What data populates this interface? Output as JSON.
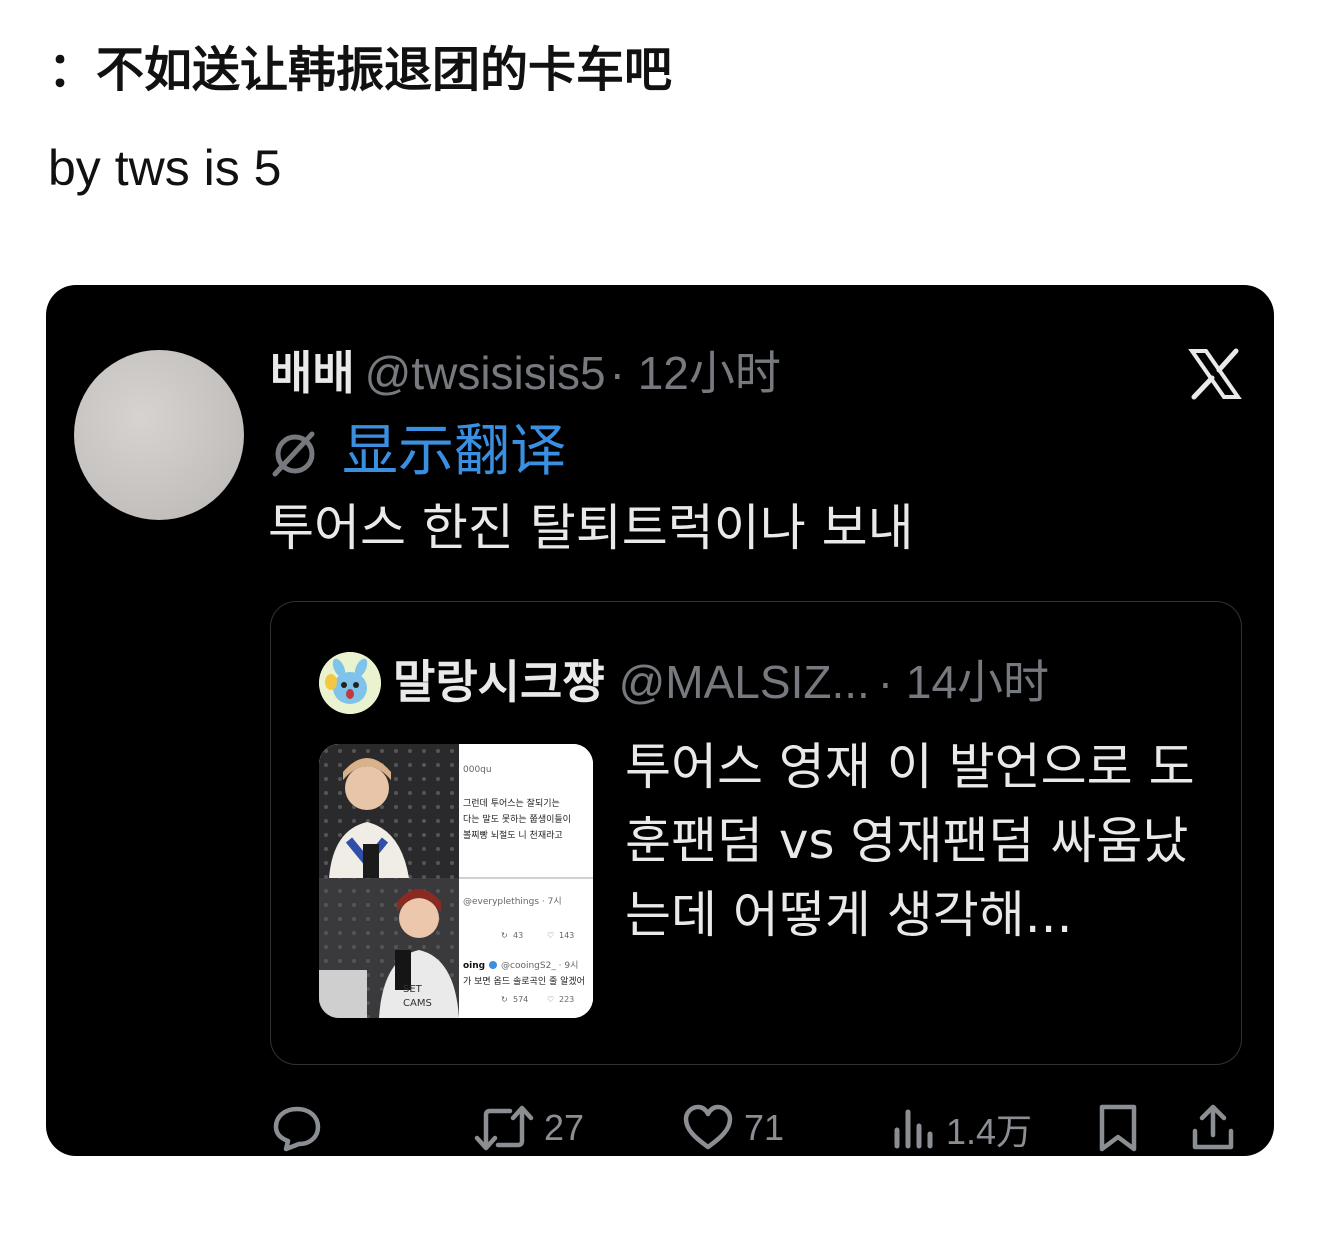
{
  "post": {
    "caption": "：不如送让韩振退团的卡车吧",
    "byline": "by tws is 5"
  },
  "tweet": {
    "display_name": "배배",
    "handle": "@twsisisis5",
    "time": "· 12小时",
    "translate_label": "显示翻译",
    "text": "투어스 한진 탈퇴트럭이나 보내"
  },
  "quoted": {
    "display_name": "말랑시크쨩",
    "handle": "@MALSIZ...",
    "time": "· 14小时",
    "text": "투어스 영재 이 발언으로 도훈팬덤 vs 영재팬덤 싸움났는데 어떻게 생각해...",
    "thumb": {
      "handle_1": "000qu",
      "line_1": "그런데 투어스는 잘되기는",
      "line_2": "다는 말도 못하는 쭙생이들이",
      "line_3": "볼찌빵 뇌절도 니 천재라고",
      "handle_2": "@everyplethings · 7시",
      "rt_2": "43",
      "like_2": "143",
      "name_3": "oing",
      "handle_3": "@cooingS2_ · 9시",
      "line_4": "가 보면 옵드 솔로곡인 줄 알겠어",
      "rt_3": "574",
      "like_3": "223"
    }
  },
  "actions": {
    "reply_count": "",
    "retweet_count": "27",
    "like_count": "71",
    "views_count": "1.4万"
  },
  "colors": {
    "card_bg": "#000000",
    "link": "#3a8fe0",
    "muted": "#76797e",
    "text": "#e9e9e9"
  }
}
